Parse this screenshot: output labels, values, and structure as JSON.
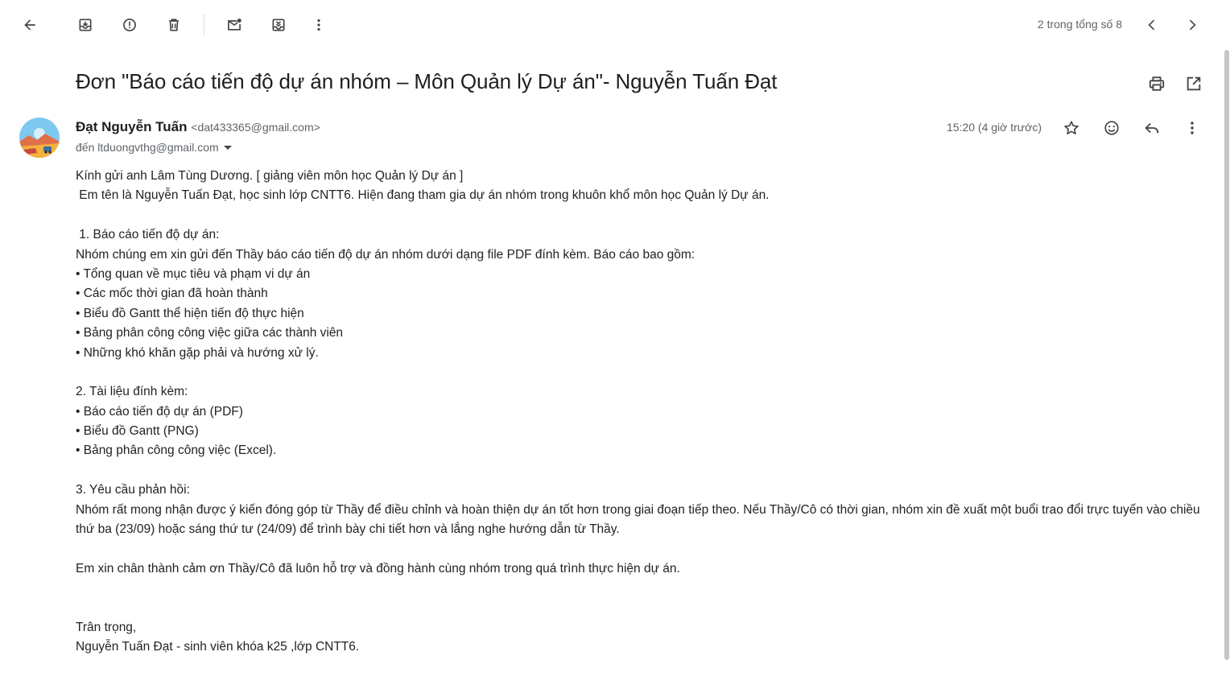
{
  "toolbar": {
    "back": "back-arrow-icon",
    "archive": "archive-icon",
    "report_spam": "report-spam-icon",
    "delete": "trash-icon",
    "mark_unread": "mark-unread-icon",
    "move_to": "move-to-icon",
    "more": "more-vertical-icon",
    "pager_text": "2 trong tổng số 8",
    "prev": "chevron-left-icon",
    "next": "chevron-right-icon"
  },
  "subject": "Đơn \"Báo cáo tiến độ dự án nhóm – Môn Quản lý Dự án\"- Nguyễn Tuấn Đạt",
  "subject_actions": {
    "print": "printer-icon",
    "open_new": "open-in-new-icon"
  },
  "message": {
    "sender_name": "Đạt Nguyễn Tuấn",
    "sender_email": "<dat433365@gmail.com>",
    "to_line": "đến ltduongvthg@gmail.com",
    "time": "15:20 (4 giờ trước)",
    "actions": {
      "star": "star-icon",
      "emoji": "emoji-icon",
      "reply": "reply-icon",
      "more": "more-vertical-icon"
    }
  },
  "body": {
    "greeting": "Kính gửi anh Lâm Tùng Dương. [ giảng viên môn học Quản lý Dự án ]",
    "intro": " Em tên là Nguyễn Tuấn Đạt, học sinh lớp CNTT6. Hiện đang tham gia dự án nhóm trong khuôn khổ môn học Quản lý Dự án.",
    "s1_title": " 1. Báo cáo tiến độ dự án:",
    "s1_text": "Nhóm chúng em xin gửi đến Thầy báo cáo tiến độ dự án nhóm dưới dạng file PDF đính kèm. Báo cáo bao gồm:",
    "s1_items": [
      "• Tổng quan về mục tiêu và phạm vi dự án",
      "• Các mốc thời gian đã hoàn thành",
      "• Biểu đồ Gantt thể hiện tiến độ thực hiện",
      "• Bảng phân công công việc giữa các thành viên",
      "• Những khó khăn gặp phải và hướng xử lý."
    ],
    "s2_title": "2. Tài liệu đính kèm:",
    "s2_items": [
      "• Báo cáo tiến độ dự án (PDF)",
      "• Biểu đồ Gantt (PNG)",
      "• Bảng phân công công việc (Excel)."
    ],
    "s3_title": "3. Yêu cầu phản hồi:",
    "s3_text": "Nhóm rất mong nhận được ý kiến đóng góp từ Thầy để điều chỉnh và hoàn thiện dự án tốt hơn trong giai đoạn tiếp theo. Nếu Thầy/Cô có thời gian, nhóm xin đề xuất một buổi trao đổi trực tuyến vào chiều thứ ba (23/09) hoặc sáng thứ tư (24/09) để trình bày chi tiết hơn và lắng nghe hướng dẫn từ Thầy.",
    "thanks": "Em xin chân thành cảm ơn Thầy/Cô đã luôn hỗ trợ và đồng hành cùng nhóm trong quá trình thực hiện dự án.",
    "closing": "Trân trọng,",
    "signature": "Nguyễn Tuấn Đạt - sinh viên khóa k25 ,lớp CNTT6."
  }
}
